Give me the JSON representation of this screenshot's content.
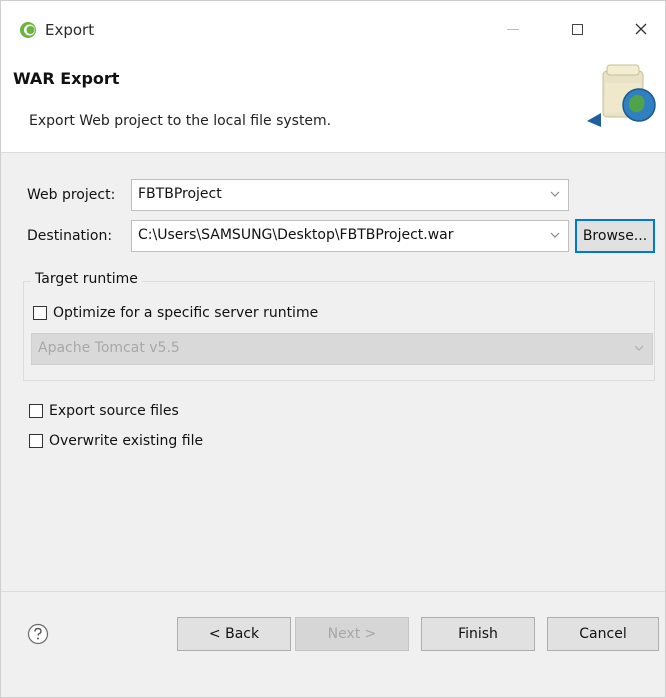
{
  "window": {
    "title": "Export"
  },
  "banner": {
    "title": "WAR Export",
    "description": "Export Web project to the local file system."
  },
  "form": {
    "web_project_label": "Web project:",
    "web_project_value": "FBTBProject",
    "destination_label": "Destination:",
    "destination_value": "C:\\Users\\SAMSUNG\\Desktop\\FBTBProject.war",
    "browse_label": "Browse..."
  },
  "target_runtime": {
    "group_label": "Target runtime",
    "optimize_label": "Optimize for a specific server runtime",
    "optimize_checked": false,
    "runtime_value": "Apache Tomcat v5.5"
  },
  "options": {
    "export_source_label": "Export source files",
    "export_source_checked": false,
    "overwrite_label": "Overwrite existing file",
    "overwrite_checked": false
  },
  "footer": {
    "back_label": "< Back",
    "next_label": "Next >",
    "finish_label": "Finish",
    "cancel_label": "Cancel"
  }
}
